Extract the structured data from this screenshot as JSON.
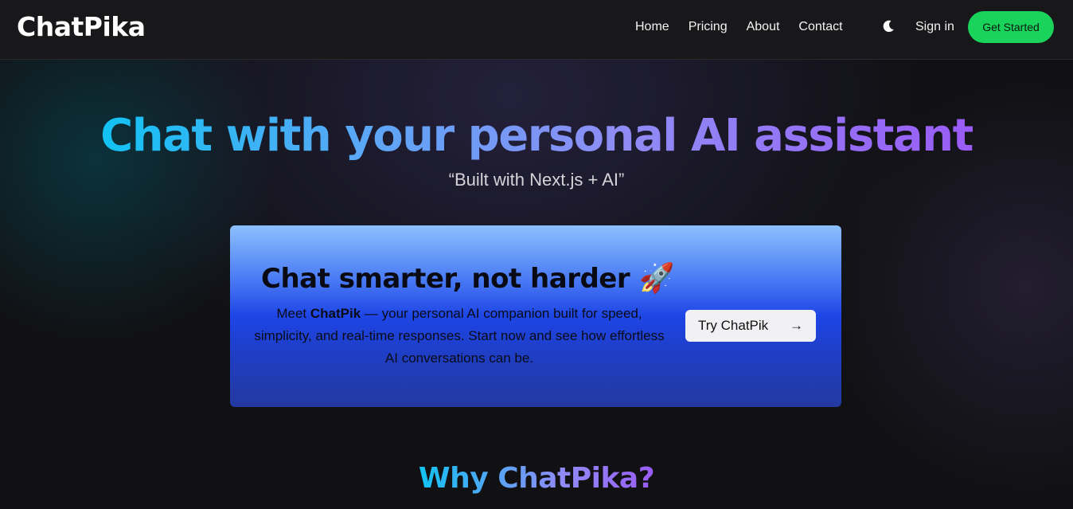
{
  "header": {
    "logo": "ChatPika",
    "nav": [
      "Home",
      "Pricing",
      "About",
      "Contact"
    ],
    "theme_toggle_icon": "moon-icon",
    "signin_label": "Sign in",
    "cta_label": "Get Started"
  },
  "hero": {
    "title": "Chat with your personal AI assistant",
    "subtitle": "“Built with Next.js + AI”"
  },
  "card": {
    "title": "Chat smarter, not harder",
    "title_emoji": "🚀",
    "desc_prefix": "Meet ",
    "desc_brand": "ChatPik",
    "desc_rest": " — your personal AI companion built for speed, simplicity, and real-time responses. Start now and see how effortless AI conversations can be.",
    "button_label": "Try ChatPik",
    "button_arrow": "→"
  },
  "features": {
    "heading": "Why ChatPika?"
  },
  "colors": {
    "accent_green": "#19d35a",
    "gradient_start": "#12c2f3",
    "gradient_end": "#9a5cf6",
    "card_top": "#8dc0fd",
    "card_bottom": "#23399f"
  }
}
